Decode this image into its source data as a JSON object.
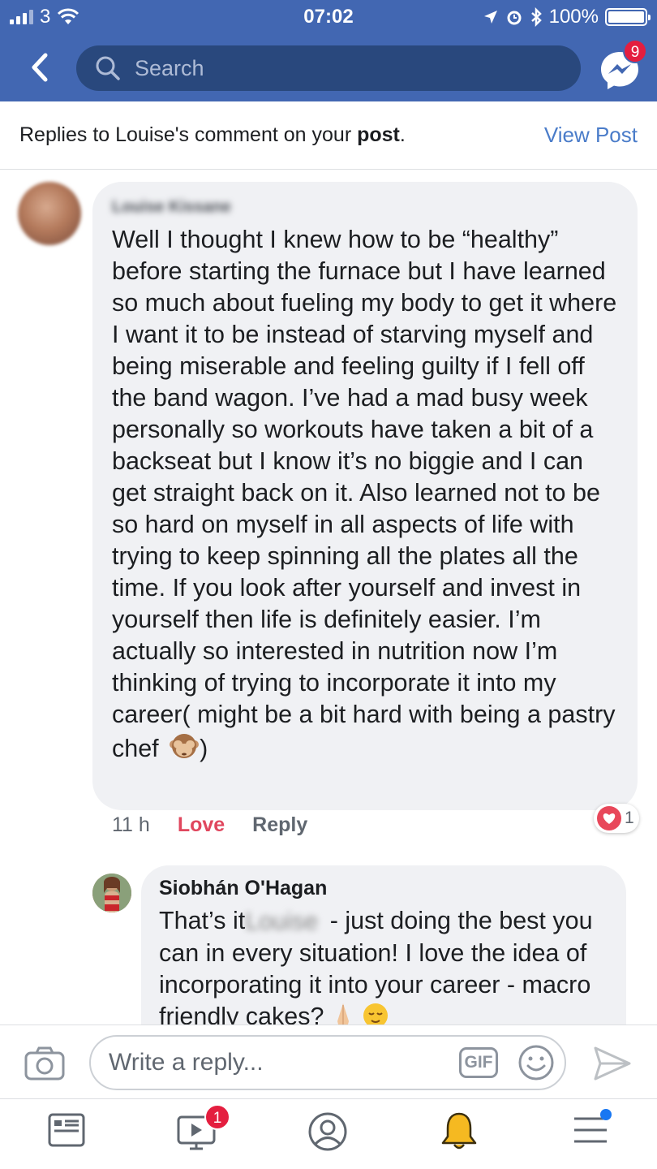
{
  "status_bar": {
    "carrier": "3",
    "time": "07:02",
    "battery": "100%"
  },
  "nav": {
    "search_placeholder": "Search",
    "messenger_badge": "9"
  },
  "header": {
    "text_before": "Replies to Louise's comment on your ",
    "text_bold": "post",
    "text_after": ".",
    "view_post": "View Post"
  },
  "comment": {
    "author": "Louise Kissane",
    "text": "Well I thought I knew how to be “healthy” before starting the furnace but I have learned so much about fueling my body to get it where I want it to be instead of starving myself and being miserable and feeling guilty if I fell off the band wagon. I’ve had a mad busy week personally so workouts have taken a bit of a backseat but I know it’s no biggie and I can get straight back on it. Also learned not to be so hard on myself in all aspects of life with trying to keep spinning all the plates all the time. If you look after yourself and invest in yourself then life is definitely easier. I’m actually so interested in nutrition now I’m thinking of trying to incorporate it into my career( might be a bit hard with being a pastry chef",
    "text_end": ")",
    "time": "11 h",
    "love_label": "Love",
    "reply_label": "Reply",
    "reaction_count": "1"
  },
  "reply": {
    "author": "Siobhán O'Hagan",
    "text_before": "That’s it",
    "blurred_name": "Louise",
    "text_after": " - just doing the best you can in every situation! I love the idea of incorporating it into your career - macro friendly cakes?"
  },
  "composer": {
    "placeholder": "Write a reply...",
    "gif_label": "GIF"
  },
  "tabbar": {
    "watch_badge": "1"
  },
  "colors": {
    "brand": "#4267b2",
    "love": "#e0475e",
    "badge": "#e41e3f",
    "link": "#4a7cc9"
  }
}
